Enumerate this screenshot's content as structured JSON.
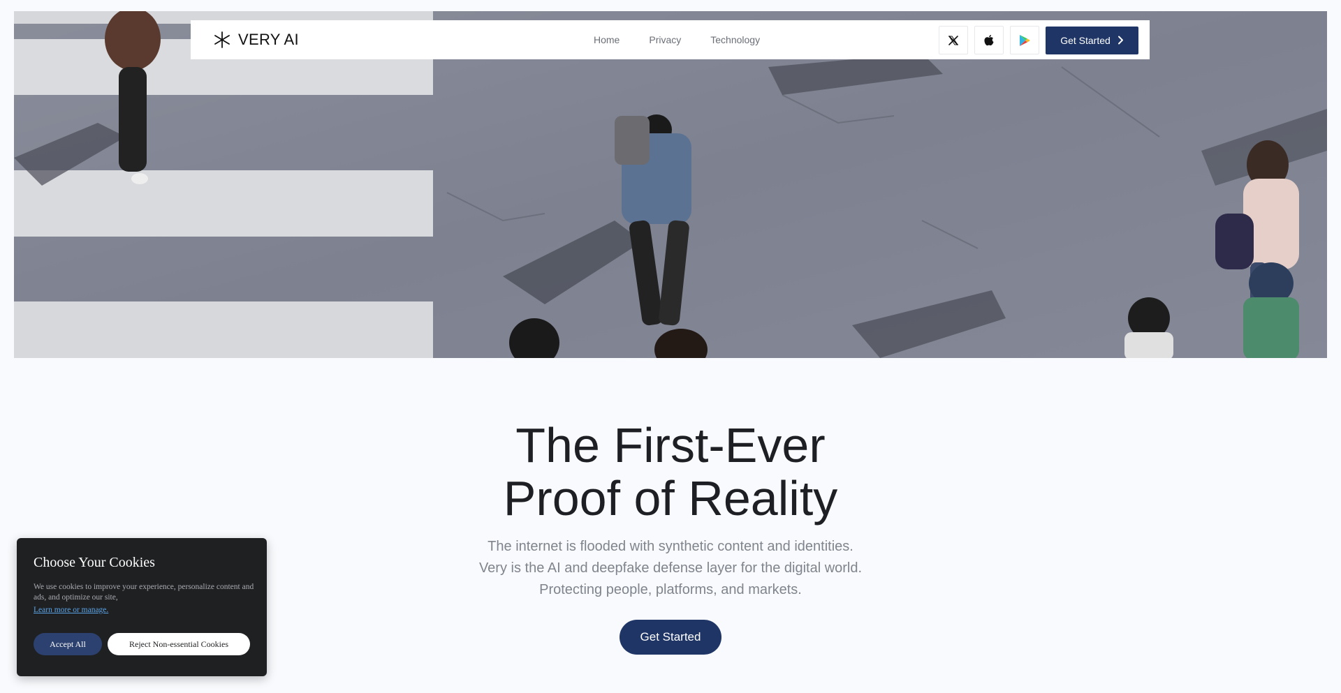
{
  "brand": {
    "name": "VERY AI",
    "icon": "asterisk-logo-icon"
  },
  "nav": {
    "links": [
      "Home",
      "Privacy",
      "Technology"
    ],
    "store_icons": [
      "x-twitter-icon",
      "apple-icon",
      "google-play-icon"
    ],
    "cta_label": "Get Started",
    "cta_icon": "chevron-right-icon"
  },
  "hero": {
    "image": "aerial-street-crosswalk-pedestrians-photo",
    "headline": [
      "The First-Ever",
      "Proof of Reality"
    ],
    "subtitle": [
      "The internet is flooded with synthetic content and identities.",
      "Very is the AI and deepfake defense layer for the digital world.",
      "Protecting people, platforms, and markets."
    ],
    "cta_label": "Get Started"
  },
  "cookie": {
    "title": "Choose Your Cookies",
    "body": "We use cookies to improve your experience, personalize content and ads, and optimize our site,",
    "link": "Learn more or manage.",
    "accept_label": "Accept All",
    "reject_label": "Reject Non-essential Cookies"
  },
  "colors": {
    "primary": "#1e3566",
    "page_bg": "#f8fafd",
    "cookie_bg": "#1f2022",
    "link": "#5aa3e6"
  }
}
